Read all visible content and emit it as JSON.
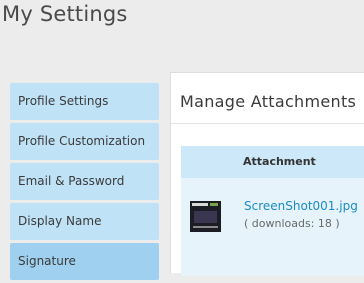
{
  "page": {
    "title": "My Settings"
  },
  "sidebar": {
    "items": [
      {
        "label": "Profile Settings"
      },
      {
        "label": "Profile Customization"
      },
      {
        "label": "Email & Password"
      },
      {
        "label": "Display Name"
      },
      {
        "label": "Signature",
        "active": true
      }
    ]
  },
  "main": {
    "title": "Manage Attachments",
    "table": {
      "header": "Attachment",
      "rows": [
        {
          "thumbnail_icon": "image-thumbnail-icon",
          "file_name": "ScreenShot001.jpg",
          "downloads_text": "( downloads: 18 )"
        }
      ]
    }
  },
  "colors": {
    "background": "#ececec",
    "sidebar_item": "#bfe2f7",
    "sidebar_item_active": "#9fd0ef",
    "table_header": "#cde8f8",
    "table_row": "#e6f3fb",
    "link": "#1a8cc7"
  }
}
